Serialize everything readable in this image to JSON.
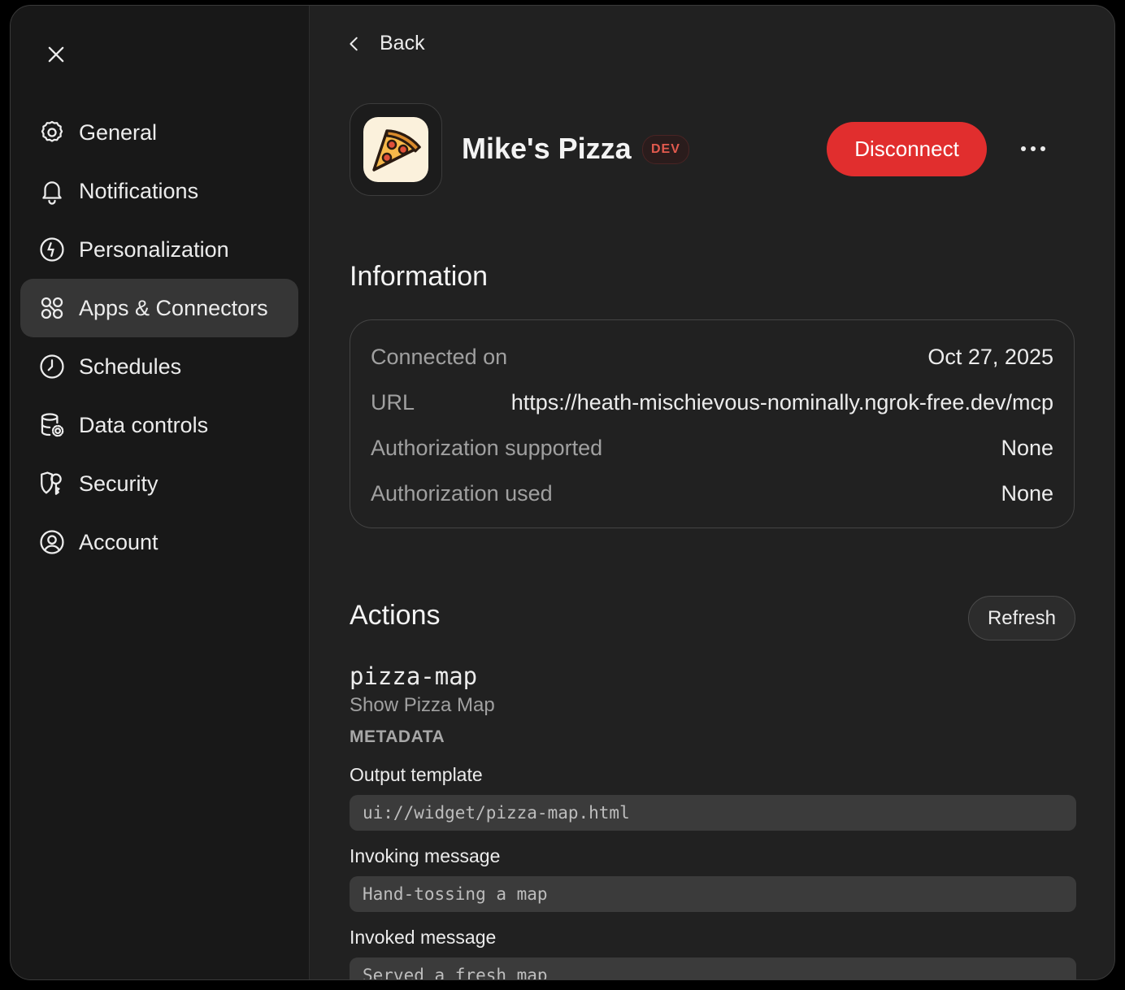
{
  "sidebar": {
    "close_icon": "close-icon",
    "items": [
      {
        "label": "General",
        "icon": "gear-icon"
      },
      {
        "label": "Notifications",
        "icon": "bell-icon"
      },
      {
        "label": "Personalization",
        "icon": "personalization-icon"
      },
      {
        "label": "Apps & Connectors",
        "icon": "apps-icon",
        "active": true
      },
      {
        "label": "Schedules",
        "icon": "clock-icon"
      },
      {
        "label": "Data controls",
        "icon": "database-gear-icon"
      },
      {
        "label": "Security",
        "icon": "shield-key-icon"
      },
      {
        "label": "Account",
        "icon": "user-circle-icon"
      }
    ]
  },
  "header": {
    "back_label": "Back",
    "app_name": "Mike's Pizza",
    "badge": "DEV",
    "disconnect_label": "Disconnect",
    "more_icon": "ellipsis-icon"
  },
  "information": {
    "title": "Information",
    "rows": [
      {
        "key": "Connected on",
        "value": "Oct 27, 2025"
      },
      {
        "key": "URL",
        "value": "https://heath-mischievous-nominally.ngrok-free.dev/mcp"
      },
      {
        "key": "Authorization supported",
        "value": "None"
      },
      {
        "key": "Authorization used",
        "value": "None"
      }
    ]
  },
  "actions": {
    "title": "Actions",
    "refresh_label": "Refresh",
    "items": [
      {
        "name": "pizza-map",
        "description": "Show Pizza Map",
        "metadata_label": "METADATA",
        "fields": [
          {
            "label": "Output template",
            "value": "ui://widget/pizza-map.html"
          },
          {
            "label": "Invoking message",
            "value": "Hand-tossing a map"
          },
          {
            "label": "Invoked message",
            "value": "Served a fresh map"
          }
        ]
      }
    ]
  },
  "colors": {
    "background": "#212121",
    "sidebar": "#181818",
    "active_item": "#363636",
    "danger": "#e12e2e",
    "badge_text": "#e35a4e"
  }
}
